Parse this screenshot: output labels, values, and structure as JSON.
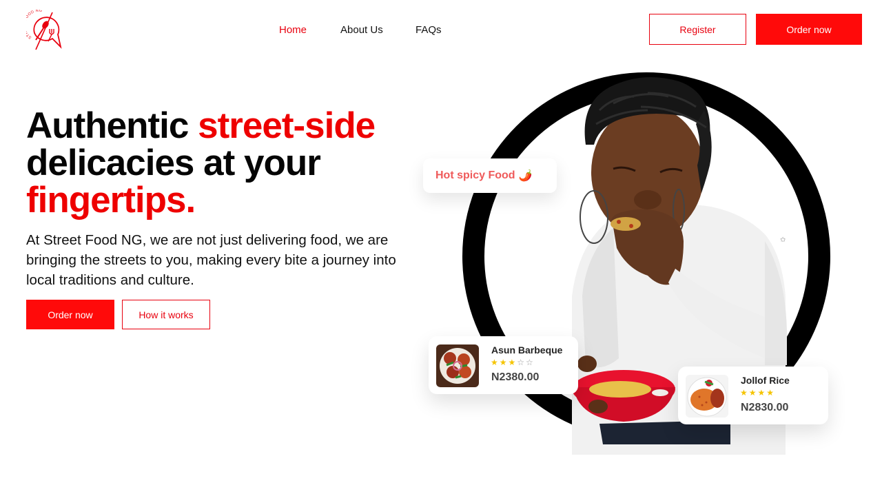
{
  "brand": {
    "logo_text": "STREET FOOD NG",
    "accent": "#e8000e",
    "accent_fill": "#ff0a0a"
  },
  "nav": {
    "items": [
      {
        "label": "Home",
        "active": true
      },
      {
        "label": "About Us",
        "active": false
      },
      {
        "label": "FAQs",
        "active": false
      }
    ],
    "register_label": "Register",
    "order_label": "Order now"
  },
  "hero": {
    "headline": {
      "part1": "Authentic ",
      "part2": "street-side",
      "part3": "delicacies at your",
      "part4": "fingertips."
    },
    "lead": "At Street Food NG, we are not just delivering food, we are bringing the streets to you, making every bite a journey into local traditions and culture.",
    "order_label": "Order now",
    "how_label": "How it works"
  },
  "bubble": {
    "text": "Hot spicy Food",
    "icon": "chili-pepper-icon",
    "emoji": "🌶️"
  },
  "cards": [
    {
      "name": "Asun Barbeque",
      "rating": 3,
      "max": 5,
      "price": "N2380.00",
      "stars_on": "★★★",
      "stars_off": "☆☆"
    },
    {
      "name": "Jollof Rice",
      "rating": 4,
      "max": 4,
      "price": "N2830.00",
      "stars_on": "★★★★",
      "stars_off": ""
    }
  ]
}
